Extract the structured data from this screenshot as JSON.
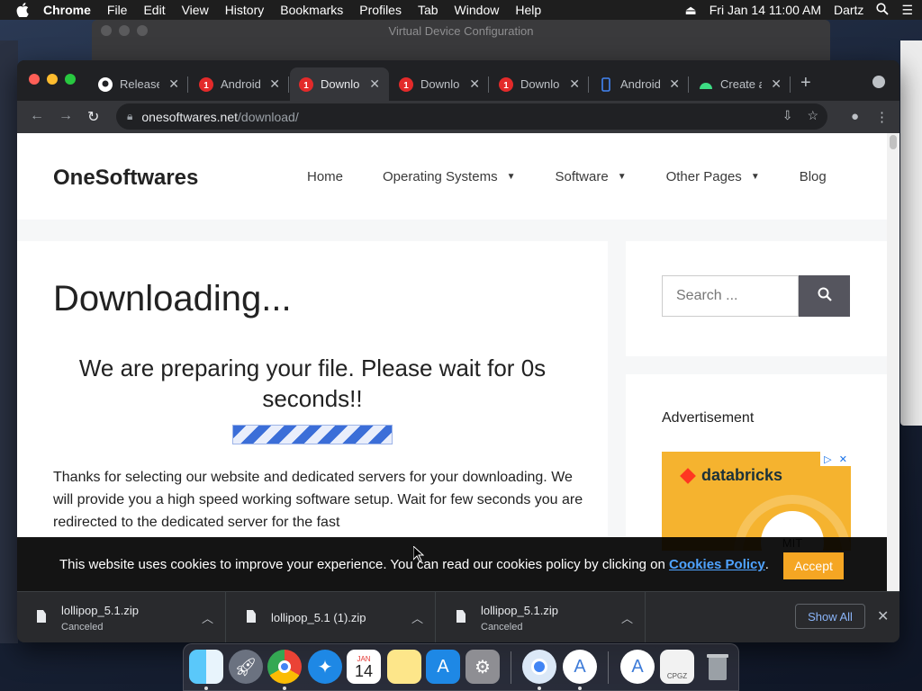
{
  "menubar": {
    "app": "Chrome",
    "items": [
      "File",
      "Edit",
      "View",
      "History",
      "Bookmarks",
      "Profiles",
      "Tab",
      "Window",
      "Help"
    ],
    "clock": "Fri Jan 14  11:00 AM",
    "user": "Dartz"
  },
  "background_window": {
    "title": "Virtual Device Configuration"
  },
  "tabs": [
    {
      "label": "Release",
      "icon": "github-icon"
    },
    {
      "label": "Android",
      "icon": "opera-icon"
    },
    {
      "label": "Downloa",
      "icon": "opera-icon",
      "active": true
    },
    {
      "label": "Downloa",
      "icon": "opera-icon"
    },
    {
      "label": "Downloa",
      "icon": "opera-icon"
    },
    {
      "label": "Android",
      "icon": "phone-icon"
    },
    {
      "label": "Create a",
      "icon": "android-icon"
    }
  ],
  "omnibox": {
    "host": "onesoftwares.net",
    "path": "/download/"
  },
  "site": {
    "title": "OneSoftwares",
    "nav": [
      {
        "label": "Home",
        "dropdown": false
      },
      {
        "label": "Operating Systems",
        "dropdown": true
      },
      {
        "label": "Software",
        "dropdown": true
      },
      {
        "label": "Other Pages",
        "dropdown": true
      },
      {
        "label": "Blog",
        "dropdown": false
      }
    ]
  },
  "main": {
    "heading": "Downloading...",
    "preparing": "We are preparing your file. Please wait for 0s seconds!!",
    "body": "Thanks for selecting our website and dedicated servers for your downloading. We will provide you a high speed working software setup. Wait for few seconds you are redirected to the dedicated server for the fast"
  },
  "sidebar": {
    "search_placeholder": "Search ...",
    "ad_label": "Advertisement",
    "ad_brand": "databricks",
    "ad_text": "MIT"
  },
  "cookie": {
    "message": "This website uses cookies to improve your experience. You can read our cookies policy by clicking on ",
    "policy_link": "Cookies Policy",
    "suffix": ".",
    "accept": "Accept"
  },
  "downloads": [
    {
      "name": "lollipop_5.1.zip",
      "status": "Canceled"
    },
    {
      "name": "lollipop_5.1 (1).zip",
      "status": ""
    },
    {
      "name": "lollipop_5.1.zip",
      "status": "Canceled"
    }
  ],
  "shelf": {
    "show_all": "Show All"
  },
  "dock": {
    "apps": [
      "finder-icon",
      "launchpad-icon",
      "chrome-icon",
      "safari-icon",
      "calendar-icon",
      "notes-icon",
      "app-store-icon",
      "system-preferences-icon",
      "chrome-dev-icon",
      "android-studio-icon",
      "android-studio-alt-icon",
      "zip-file-icon",
      "trash-icon"
    ],
    "calendar_month": "JAN",
    "calendar_day": "14",
    "zip_label": "CPGZ"
  },
  "colors": {
    "accept": "#f5a623",
    "policy_link": "#4fa3ff",
    "search_button": "#55555e",
    "ad_bg": "#f5b32f"
  }
}
